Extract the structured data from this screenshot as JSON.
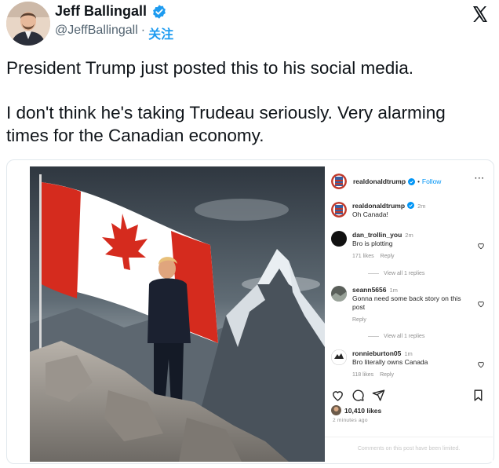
{
  "author": {
    "display_name": "Jeff Ballingall",
    "handle": "@JeffBallingall",
    "separator": "·",
    "follow_label": "关注",
    "verified_icon": "verified-badge-icon",
    "accent_color": "#1d9bf0"
  },
  "tweet": {
    "paragraphs": [
      "President Trump just posted this to his social media.",
      "I don't think he's taking Trudeau seriously. Very alarming times for the Canadian economy."
    ]
  },
  "instagram": {
    "header": {
      "username": "realdonaldtrump",
      "separator": "•",
      "follow_label": "Follow",
      "more_label": "···"
    },
    "caption": {
      "username": "realdonaldtrump",
      "time": "2m",
      "text": "Oh Canada!"
    },
    "comments": [
      {
        "username": "dan_trollin_you",
        "time": "2m",
        "text": "Bro is plotting",
        "likes": "171 likes",
        "reply_label": "Reply",
        "view_replies": "View all 1 replies"
      },
      {
        "username": "seann5656",
        "time": "1m",
        "text": "Gonna need some back story on this post",
        "likes": "",
        "reply_label": "Reply",
        "view_replies": "View all 1 replies"
      },
      {
        "username": "ronnieburton05",
        "time": "1m",
        "text": "Bro literally owns Canada",
        "likes": "118 likes",
        "reply_label": "Reply"
      }
    ],
    "likes_count": "10,410 likes",
    "posted_time": "2 minutes ago",
    "comments_limited": "Comments on this post have been limited."
  }
}
